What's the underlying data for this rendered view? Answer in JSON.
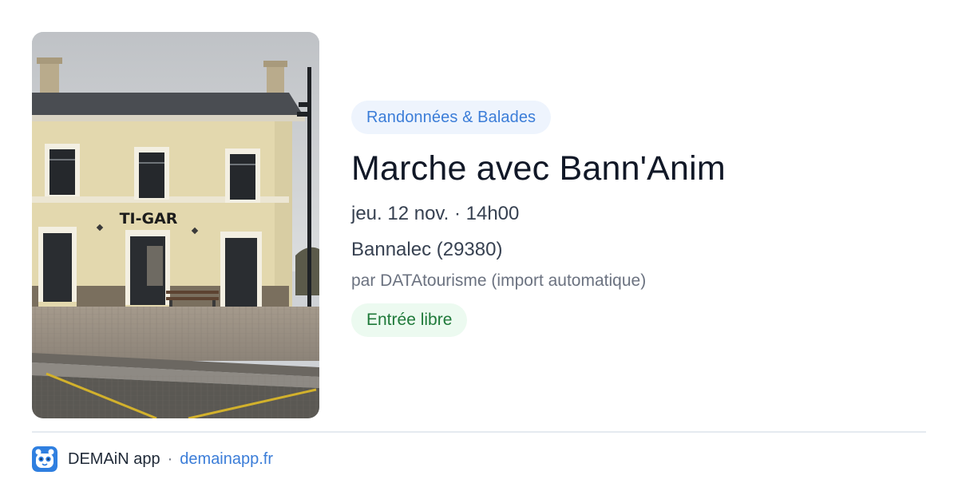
{
  "photo": {
    "alt": "Gare TI-GAR",
    "sign_text": "TI-GAR"
  },
  "event": {
    "category": "Randonnées & Balades",
    "title": "Marche avec Bann'Anim",
    "date": "jeu. 12 nov. · 14h00",
    "location": "Bannalec (29380)",
    "source": "par DATAtourisme (import automatique)",
    "price": "Entrée libre"
  },
  "footer": {
    "app_name": "DEMAiN app",
    "separator": "·",
    "link": "demainapp.fr",
    "logo_icon": "demain-app-logo-icon"
  },
  "colors": {
    "accent": "#3b7dd8",
    "category_bg": "#eef4fd",
    "price_text": "#1f7a3a",
    "price_bg": "#ecfaf0"
  }
}
